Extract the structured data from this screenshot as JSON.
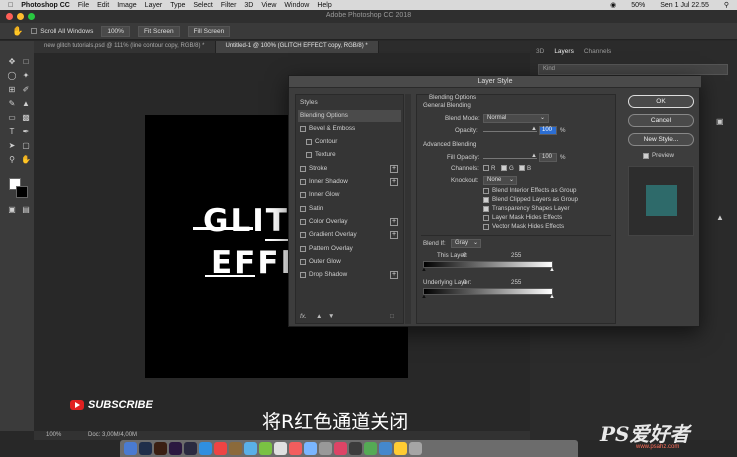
{
  "menubar": {
    "app": "Photoshop CC",
    "items": [
      "File",
      "Edit",
      "Image",
      "Layer",
      "Type",
      "Select",
      "Filter",
      "3D",
      "View",
      "Window",
      "Help"
    ],
    "battery": "50%",
    "datetime": "Sen 1 Jul  22.55"
  },
  "window": {
    "title": "Adobe Photoshop CC 2018"
  },
  "options": {
    "scroll_all_windows": "Scroll All Windows",
    "zoom_100": "100%",
    "fit_screen": "Fit Screen",
    "fill_screen": "Fill Screen"
  },
  "tabs": [
    {
      "label": "new glitch tutorials.psd @ 111% (line contour copy, RGB/8) *"
    },
    {
      "label": "Untitled-1 @ 100% (GLITCH EFFECT copy, RGB/8) *"
    }
  ],
  "canvas": {
    "line1": "GLITCH",
    "line2": "EFFECT"
  },
  "overlay": {
    "subscribe": "SUBSCRIBE",
    "subtitle": "将R红色通道关闭"
  },
  "status": {
    "zoom": "100%",
    "doc": "Doc: 3,00M/4,00M"
  },
  "panels": {
    "tabs": [
      "3D",
      "Layers",
      "Channels"
    ],
    "kind": "Kind"
  },
  "dialog": {
    "title": "Layer Style",
    "styles_header": "Styles",
    "effects": [
      {
        "label": "Blending Options",
        "selected": true,
        "checkbox": false,
        "plus": false
      },
      {
        "label": "Bevel & Emboss",
        "checkbox": true,
        "plus": false
      },
      {
        "label": "Contour",
        "checkbox": true,
        "plus": false,
        "indent": true
      },
      {
        "label": "Texture",
        "checkbox": true,
        "plus": false,
        "indent": true
      },
      {
        "label": "Stroke",
        "checkbox": true,
        "plus": true
      },
      {
        "label": "Inner Shadow",
        "checkbox": true,
        "plus": true
      },
      {
        "label": "Inner Glow",
        "checkbox": true,
        "plus": false
      },
      {
        "label": "Satin",
        "checkbox": true,
        "plus": false
      },
      {
        "label": "Color Overlay",
        "checkbox": true,
        "plus": true
      },
      {
        "label": "Gradient Overlay",
        "checkbox": true,
        "plus": true
      },
      {
        "label": "Pattern Overlay",
        "checkbox": true,
        "plus": false
      },
      {
        "label": "Outer Glow",
        "checkbox": true,
        "plus": false
      },
      {
        "label": "Drop Shadow",
        "checkbox": true,
        "plus": true
      }
    ],
    "fx_label": "fx.",
    "blending": {
      "section": "Blending Options",
      "general": "General Blending",
      "blend_mode_label": "Blend Mode:",
      "blend_mode": "Normal",
      "opacity_label": "Opacity:",
      "opacity": "100",
      "advanced": "Advanced Blending",
      "fill_opacity_label": "Fill Opacity:",
      "fill_opacity": "100",
      "pct": "%",
      "channels_label": "Channels:",
      "channels": [
        {
          "name": "R",
          "checked": false
        },
        {
          "name": "G",
          "checked": true
        },
        {
          "name": "B",
          "checked": true
        }
      ],
      "knockout_label": "Knockout:",
      "knockout": "None",
      "options": [
        {
          "label": "Blend Interior Effects as Group",
          "checked": false
        },
        {
          "label": "Blend Clipped Layers as Group",
          "checked": true
        },
        {
          "label": "Transparency Shapes Layer",
          "checked": true
        },
        {
          "label": "Layer Mask Hides Effects",
          "checked": false
        },
        {
          "label": "Vector Mask Hides Effects",
          "checked": false
        }
      ],
      "blend_if_label": "Blend If:",
      "blend_if": "Gray",
      "this_layer_label": "This Layer:",
      "this_layer": [
        "0",
        "255"
      ],
      "underlying_label": "Underlying Layer:",
      "underlying": [
        "0",
        "255"
      ]
    },
    "buttons": {
      "ok": "OK",
      "cancel": "Cancel",
      "new_style": "New Style..."
    },
    "preview_label": "Preview",
    "preview_checked": true,
    "preview_color": "#2e6a6a"
  },
  "watermark": {
    "main": "PS爱好者",
    "url": "www.psahz.com"
  }
}
